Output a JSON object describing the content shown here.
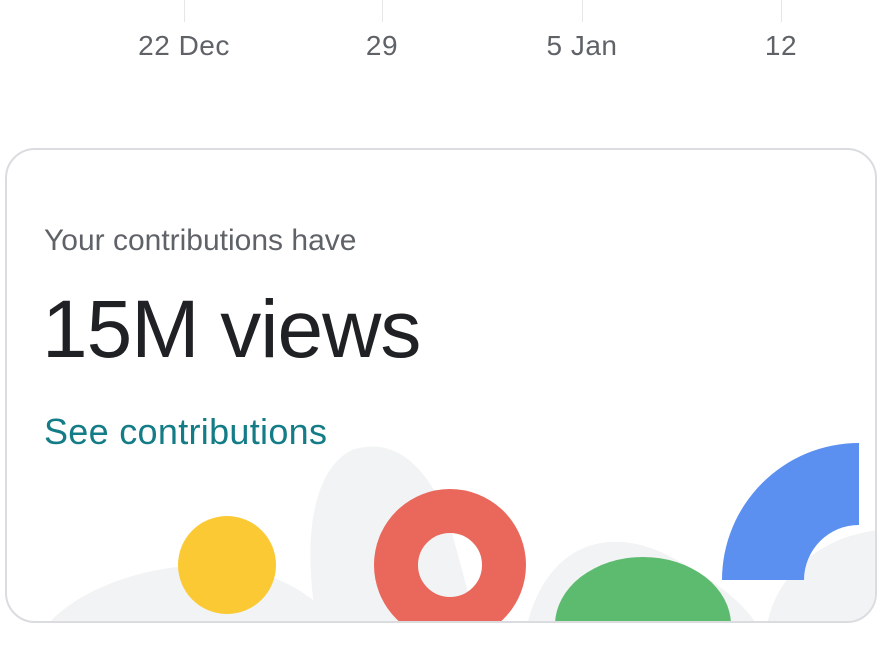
{
  "timeline": {
    "ticks": [
      "22 Dec",
      "29",
      "5 Jan",
      "12"
    ]
  },
  "contributions_card": {
    "subtitle": "Your contributions have",
    "metric": "15M views",
    "link_label": "See contributions"
  },
  "colors": {
    "link": "#137c86",
    "yellow": "#fbc934",
    "red": "#e9675b",
    "green": "#5dbb6f",
    "blue": "#5b8ff0",
    "decor_gray": "#f1f3f4"
  }
}
